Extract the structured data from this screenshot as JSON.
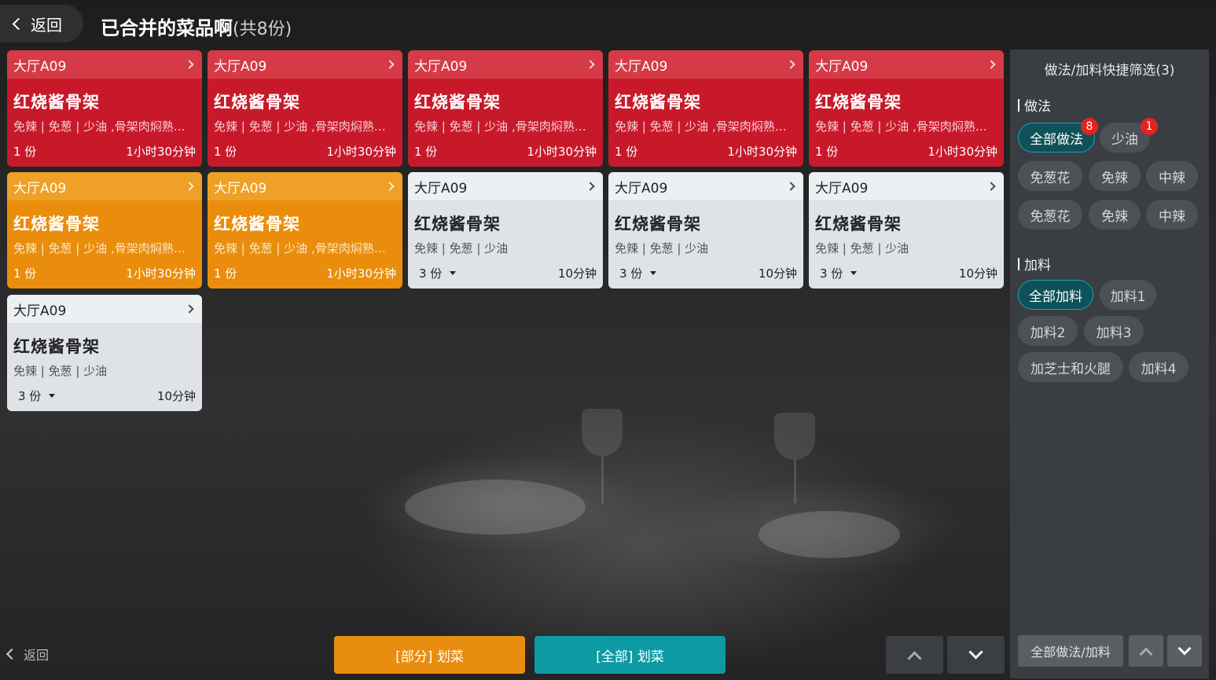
{
  "header": {
    "back_label": "返回",
    "title": "已合并的菜品啊",
    "count_label": "(共8份)"
  },
  "cards": [
    {
      "table": "大厅A09",
      "dish": "红烧酱骨架",
      "notes": "免辣 | 免葱 | 少油 ,骨架肉焖熟一...",
      "qty": "1 份",
      "time": "1小时30分钟",
      "status": "red"
    },
    {
      "table": "大厅A09",
      "dish": "红烧酱骨架",
      "notes": "免辣 | 免葱 | 少油 ,骨架肉焖熟一...",
      "qty": "1 份",
      "time": "1小时30分钟",
      "status": "red"
    },
    {
      "table": "大厅A09",
      "dish": "红烧酱骨架",
      "notes": "免辣 | 免葱 | 少油 ,骨架肉焖熟一...",
      "qty": "1 份",
      "time": "1小时30分钟",
      "status": "red"
    },
    {
      "table": "大厅A09",
      "dish": "红烧酱骨架",
      "notes": "免辣 | 免葱 | 少油 ,骨架肉焖熟一...",
      "qty": "1 份",
      "time": "1小时30分钟",
      "status": "red"
    },
    {
      "table": "大厅A09",
      "dish": "红烧酱骨架",
      "notes": "免辣 | 免葱 | 少油 ,骨架肉焖熟一...",
      "qty": "1 份",
      "time": "1小时30分钟",
      "status": "red"
    },
    {
      "table": "大厅A09",
      "dish": "红烧酱骨架",
      "notes": "免辣 | 免葱 | 少油 ,骨架肉焖熟一...",
      "qty": "1 份",
      "time": "1小时30分钟",
      "status": "orange"
    },
    {
      "table": "大厅A09",
      "dish": "红烧酱骨架",
      "notes": "免辣 | 免葱 | 少油 ,骨架肉焖熟一...",
      "qty": "1 份",
      "time": "1小时30分钟",
      "status": "orange"
    },
    {
      "table": "大厅A09",
      "dish": "红烧酱骨架",
      "notes": "免辣 | 免葱 | 少油",
      "qty": "3 份",
      "time": "10分钟",
      "status": "gray"
    },
    {
      "table": "大厅A09",
      "dish": "红烧酱骨架",
      "notes": "免辣 | 免葱 | 少油",
      "qty": "3 份",
      "time": "10分钟",
      "status": "gray"
    },
    {
      "table": "大厅A09",
      "dish": "红烧酱骨架",
      "notes": "免辣 | 免葱 | 少油",
      "qty": "3 份",
      "time": "10分钟",
      "status": "gray"
    },
    {
      "table": "大厅A09",
      "dish": "红烧酱骨架",
      "notes": "免辣 | 免葱 | 少油",
      "qty": "3 份",
      "time": "10分钟",
      "status": "gray"
    }
  ],
  "filter_panel": {
    "title": "做法/加料快捷筛选(3)",
    "methods": {
      "label": "做法",
      "chips": [
        {
          "label": "全部做法",
          "badge": "8",
          "active": true
        },
        {
          "label": "少油",
          "badge": "1",
          "active": false
        },
        {
          "label": "免葱花"
        },
        {
          "label": "免辣"
        },
        {
          "label": "中辣"
        },
        {
          "label": "免葱花"
        },
        {
          "label": "免辣"
        },
        {
          "label": "中辣"
        }
      ]
    },
    "toppings": {
      "label": "加料",
      "chips": [
        {
          "label": "全部加料",
          "active": true
        },
        {
          "label": "加料1"
        },
        {
          "label": "加料2"
        },
        {
          "label": "加料3"
        },
        {
          "label": "加芝士和火腿"
        },
        {
          "label": "加料4"
        }
      ]
    },
    "all_button": "全部做法/加料"
  },
  "bottom": {
    "back_label": "返回",
    "partial_button": "[部分] 划菜",
    "all_button": "[全部] 划菜"
  },
  "colors": {
    "red": "#c8192b",
    "orange": "#ea8d0c",
    "gray": "#dfe3e8",
    "teal": "#0e9aa5",
    "accent_orange": "#e98d10"
  }
}
